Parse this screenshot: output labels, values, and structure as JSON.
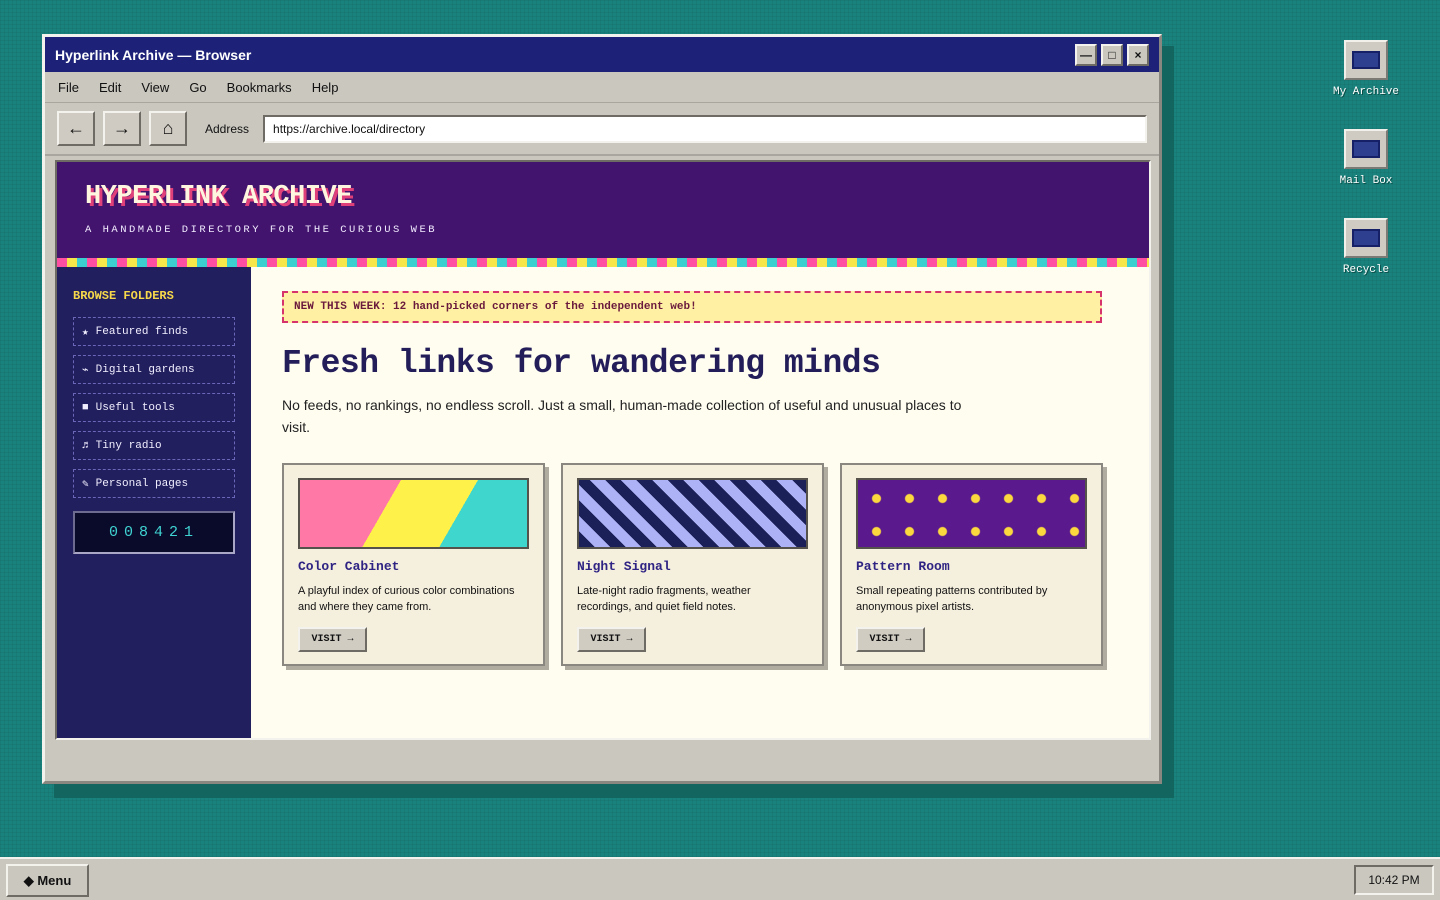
{
  "desktop": {
    "icons": [
      {
        "label": "My Archive",
        "icon": "archive-icon"
      },
      {
        "label": "Mail Box",
        "icon": "mail-icon"
      },
      {
        "label": "Recycle",
        "icon": "recycle-icon"
      }
    ]
  },
  "window": {
    "title": "Hyperlink Archive — Browser",
    "controls": {
      "minimize": "—",
      "maximize": "□",
      "close": "×"
    }
  },
  "menubar": [
    "File",
    "Edit",
    "View",
    "Go",
    "Bookmarks",
    "Help"
  ],
  "toolbar": {
    "back": "←",
    "forward": "→",
    "home": "⌂",
    "address_label": "Address",
    "address_value": "https://archive.local/directory"
  },
  "site": {
    "title": "HYPERLINK ARCHIVE",
    "subtitle": "A HANDMADE DIRECTORY FOR THE CURIOUS WEB"
  },
  "sidebar": {
    "heading": "BROWSE FOLDERS",
    "items": [
      {
        "glyph": "★",
        "label": "Featured finds"
      },
      {
        "glyph": "⌁",
        "label": "Digital gardens"
      },
      {
        "glyph": "■",
        "label": "Useful tools"
      },
      {
        "glyph": "♬",
        "label": "Tiny radio"
      },
      {
        "glyph": "✎",
        "label": "Personal pages"
      }
    ],
    "counter": "008421"
  },
  "main": {
    "notice": "NEW THIS WEEK: 12 hand-picked corners of the independent web!",
    "headline": "Fresh links for wandering minds",
    "lede": "No feeds, no rankings, no endless scroll. Just a small, human-made collection of useful and unusual places to visit.",
    "cards": [
      {
        "title": "Color Cabinet",
        "desc": "A playful index of curious color combinations and where they came from.",
        "button": "VISIT →"
      },
      {
        "title": "Night Signal",
        "desc": "Late-night radio fragments, weather recordings, and quiet field notes.",
        "button": "VISIT →"
      },
      {
        "title": "Pattern Room",
        "desc": "Small repeating patterns contributed by anonymous pixel artists.",
        "button": "VISIT →"
      }
    ]
  },
  "taskbar": {
    "start_label": "◆ Menu",
    "clock": "10:42 PM"
  },
  "colors": {
    "desktop": "#1a827c",
    "titlebar": "#1d2278",
    "site_header": "#42146e",
    "sidebar": "#221f5e",
    "accent_pink": "#ff4fa3",
    "accent_yellow": "#f6e64a",
    "accent_cyan": "#3bcfd0"
  }
}
